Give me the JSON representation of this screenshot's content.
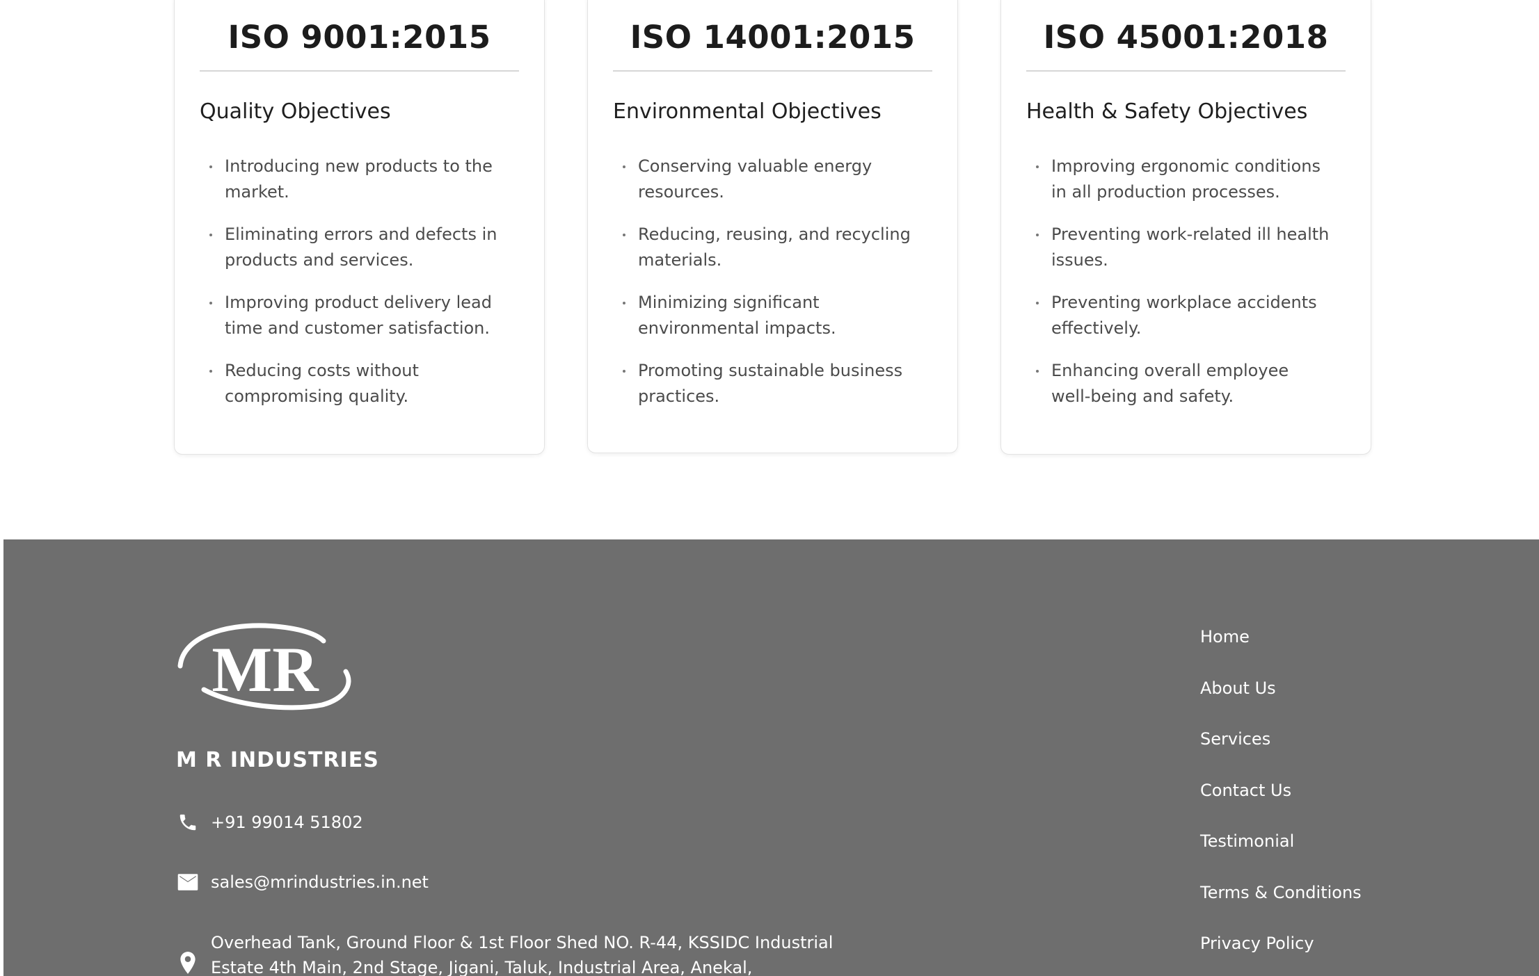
{
  "cards": [
    {
      "title": "ISO 9001:2015",
      "subtitle": "Quality Objectives",
      "items": [
        "Introducing new products to the market.",
        "Eliminating errors and defects in products and services.",
        "Improving product delivery lead time and customer satisfaction.",
        "Reducing costs without compromising quality."
      ]
    },
    {
      "title": "ISO 14001:2015",
      "subtitle": "Environmental Objectives",
      "items": [
        "Conserving valuable energy resources.",
        "Reducing, reusing, and recycling materials.",
        "Minimizing significant environmental impacts.",
        "Promoting sustainable business practices."
      ]
    },
    {
      "title": "ISO 45001:2018",
      "subtitle": "Health & Safety Objectives",
      "items": [
        "Improving ergonomic conditions in all production processes.",
        "Preventing work-related ill health issues.",
        "Preventing workplace accidents effectively.",
        "Enhancing overall employee well-being and safety."
      ]
    }
  ],
  "footer": {
    "logo_text": "MR",
    "company_name": "M R INDUSTRIES",
    "phone": "+91 99014 51802",
    "email": "sales@mrindustries.in.net",
    "address_line1": "Overhead Tank, Ground Floor & 1st Floor Shed NO. R-44, KSSIDC Industrial",
    "address_line2": "Estate 4th Main, 2nd Stage, Jigani, Taluk, Industrial Area, Anekal,",
    "links": [
      "Home",
      "About Us",
      "Services",
      "Contact Us",
      "Testimonial",
      "Terms & Conditions",
      "Privacy Policy"
    ],
    "background_color": "#6e6e6e",
    "text_color": "#ffffff"
  },
  "icons": {
    "phone": "phone-icon",
    "email": "mail-icon",
    "address": "location-pin-icon"
  }
}
